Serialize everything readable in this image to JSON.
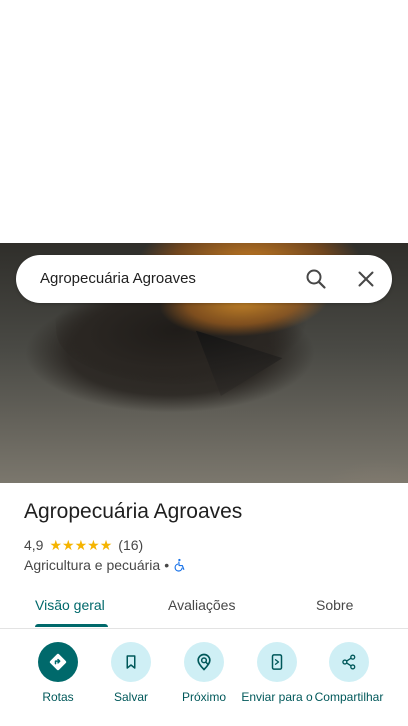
{
  "search": {
    "value": "Agropecuária Agroaves"
  },
  "place": {
    "name": "Agropecuária Agroaves",
    "rating": "4,9",
    "stars": 5,
    "review_count": "(16)",
    "category": "Agricultura e pecuária",
    "separator": "•"
  },
  "tabs": [
    {
      "label": "Visão geral",
      "active": true
    },
    {
      "label": "Avaliações",
      "active": false
    },
    {
      "label": "Sobre",
      "active": false
    }
  ],
  "actions": [
    {
      "label": "Rotas",
      "icon": "directions-icon"
    },
    {
      "label": "Salvar",
      "icon": "bookmark-icon"
    },
    {
      "label": "Próximo",
      "icon": "nearby-icon"
    },
    {
      "label": "Enviar para o",
      "icon": "send-to-phone-icon"
    },
    {
      "label": "Compartilhar",
      "icon": "share-icon"
    }
  ],
  "colors": {
    "accent": "#00696b",
    "star": "#f5b400",
    "action_bg": "#cfeff5",
    "wheelchair": "#1a73e8"
  }
}
